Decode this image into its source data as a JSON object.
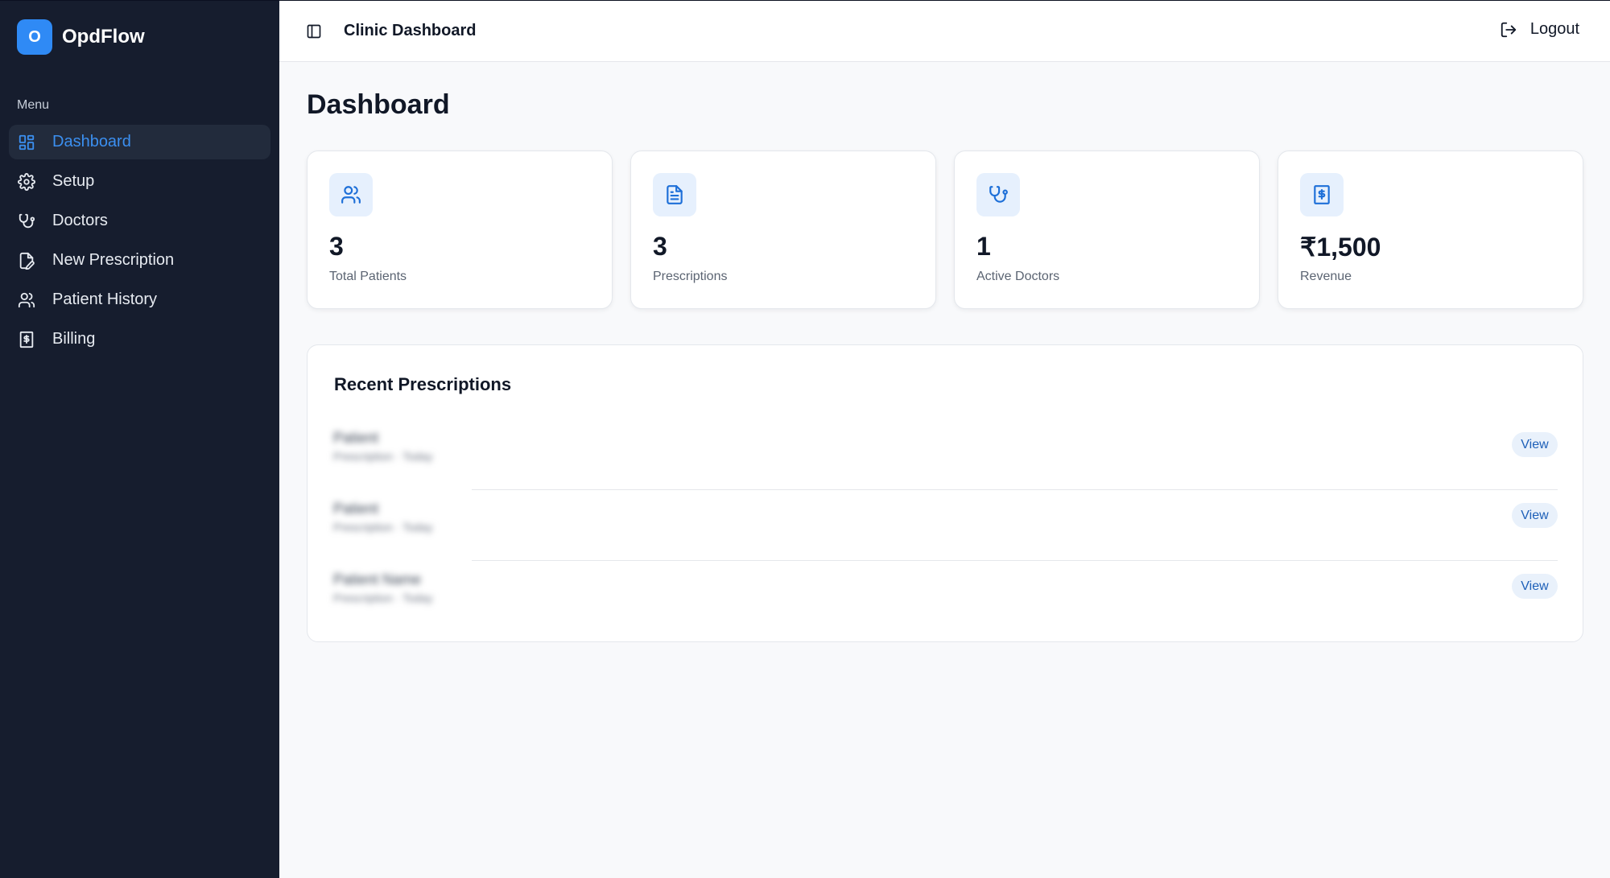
{
  "brand": {
    "logo_letter": "O",
    "name": "OpdFlow",
    "accent": "#2f8af5"
  },
  "sidebar": {
    "menu_label": "Menu",
    "items": [
      {
        "label": "Dashboard",
        "icon": "layout-grid-icon",
        "active": true
      },
      {
        "label": "Setup",
        "icon": "gear-icon"
      },
      {
        "label": "Doctors",
        "icon": "stethoscope-icon"
      },
      {
        "label": "New Prescription",
        "icon": "file-pen-icon"
      },
      {
        "label": "Patient History",
        "icon": "users-icon"
      },
      {
        "label": "Billing",
        "icon": "receipt-icon"
      }
    ]
  },
  "header": {
    "title": "Clinic Dashboard",
    "logout_label": "Logout"
  },
  "main": {
    "page_title": "Dashboard",
    "stats": [
      {
        "value": "3",
        "label": "Total Patients",
        "icon": "users-icon"
      },
      {
        "value": "3",
        "label": "Prescriptions",
        "icon": "file-text-icon"
      },
      {
        "value": "1",
        "label": "Active Doctors",
        "icon": "stethoscope-icon"
      },
      {
        "value": "₹1,500",
        "label": "Revenue",
        "icon": "receipt-icon"
      }
    ],
    "recent": {
      "title": "Recent Prescriptions",
      "rows": [
        {
          "name": "Patient",
          "meta": "Prescription · Today",
          "action": "View"
        },
        {
          "name": "Patient",
          "meta": "Prescription · Today",
          "action": "View"
        },
        {
          "name": "Patient Name",
          "meta": "Prescription · Today",
          "action": "View"
        }
      ]
    }
  }
}
